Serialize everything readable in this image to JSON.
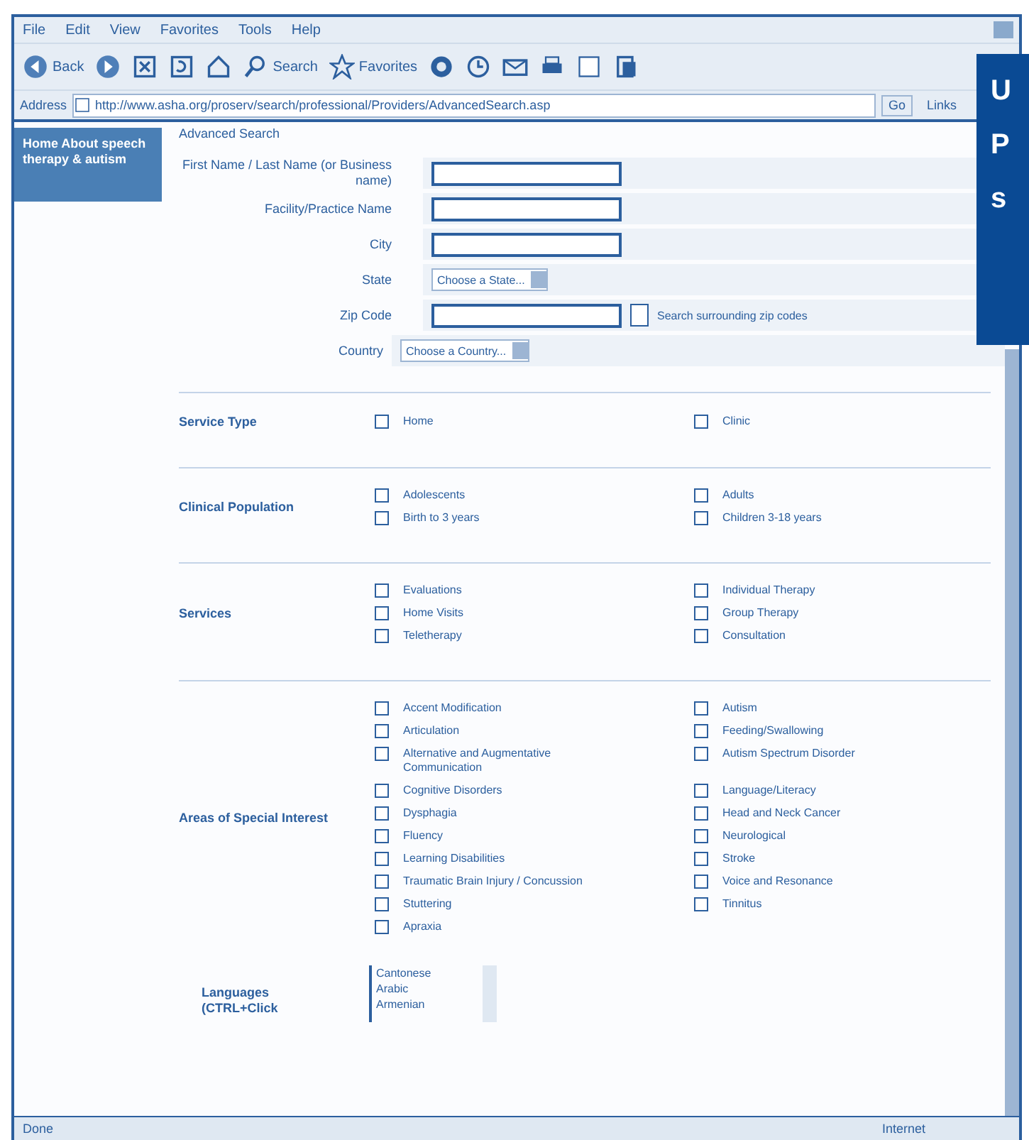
{
  "menu": [
    "File",
    "Edit",
    "View",
    "Favorites",
    "Tools",
    "Help"
  ],
  "toolbar": [
    {
      "kind": "back",
      "label": "Back"
    },
    {
      "kind": "forward"
    },
    {
      "kind": "stop"
    },
    {
      "kind": "refresh"
    },
    {
      "kind": "home"
    },
    {
      "kind": "search",
      "label": "Search"
    },
    {
      "kind": "favorites",
      "label": "Favorites"
    },
    {
      "kind": "media"
    },
    {
      "kind": "history"
    },
    {
      "kind": "mail"
    },
    {
      "kind": "print"
    },
    {
      "kind": "edit"
    },
    {
      "kind": "discuss"
    }
  ],
  "address": {
    "label": "Address",
    "value": "http://www.asha.org/proserv/search/professional/Providers/AdvancedSearch.asp",
    "go": "Go",
    "links": "Links"
  },
  "sidebar": {
    "text": "Home About speech therapy & autism"
  },
  "page_title": "Advanced Search",
  "fields": [
    {
      "kind": "text",
      "label": "First Name / Last Name (or Business name)"
    },
    {
      "kind": "text",
      "label": "Facility/Practice Name"
    },
    {
      "kind": "text",
      "label": "City"
    },
    {
      "kind": "select",
      "label": "State",
      "value": "Choose a State..."
    },
    {
      "kind": "zip",
      "label": "Zip Code",
      "check": "Search surrounding zip codes",
      "checked": false
    },
    {
      "kind": "select",
      "label": "Country",
      "value": "Choose a Country..."
    }
  ],
  "sections": [
    {
      "label": "Service Type",
      "options": [
        {
          "text": "Home",
          "checked": false
        },
        {
          "text": "Clinic",
          "checked": false
        }
      ]
    },
    {
      "label": "Clinical Population",
      "options": [
        {
          "text": "Adolescents",
          "checked": false
        },
        {
          "text": "Adults",
          "checked": false
        },
        {
          "text": "Birth to 3 years",
          "checked": false
        },
        {
          "text": "Children 3-18 years",
          "checked": false
        }
      ]
    },
    {
      "label": "Services",
      "options": [
        {
          "text": "Evaluations",
          "checked": false
        },
        {
          "text": "Individual Therapy",
          "checked": false
        },
        {
          "text": "Home Visits",
          "checked": false
        },
        {
          "text": "Group Therapy",
          "checked": false
        },
        {
          "text": "Teletherapy",
          "checked": false
        },
        {
          "text": "Consultation",
          "checked": false
        }
      ]
    },
    {
      "label": "Areas of Special Interest",
      "options": [
        {
          "text": "Accent Modification",
          "checked": false
        },
        {
          "text": "Autism",
          "checked": false
        },
        {
          "text": "Articulation",
          "checked": false
        },
        {
          "text": "Feeding/Swallowing",
          "checked": false
        },
        {
          "text": "Alternative and Augmentative Communication",
          "checked": false
        },
        {
          "text": "Autism Spectrum Disorder",
          "checked": false
        },
        {
          "text": "Cognitive Disorders",
          "checked": false
        },
        {
          "text": "Language/Literacy",
          "checked": false
        },
        {
          "text": "Dysphagia",
          "checked": false
        },
        {
          "text": "Head and Neck Cancer",
          "checked": false
        },
        {
          "text": "Fluency",
          "checked": false
        },
        {
          "text": "Neurological",
          "checked": false
        },
        {
          "text": "Learning Disabilities",
          "checked": false
        },
        {
          "text": "Stroke",
          "checked": false
        },
        {
          "text": "Traumatic Brain Injury / Concussion",
          "checked": false
        },
        {
          "text": "Voice and Resonance",
          "checked": false
        },
        {
          "text": "Stuttering",
          "checked": false
        },
        {
          "text": "Tinnitus",
          "checked": false
        },
        {
          "text": "Apraxia",
          "checked": false
        }
      ]
    }
  ],
  "languages": {
    "label": "Languages (CTRL+Click",
    "options": [
      "Cantonese",
      "Arabic",
      "Armenian"
    ]
  },
  "status_bar": {
    "text": "Done",
    "zone": "Internet"
  },
  "overlay": [
    "U",
    "P",
    "s"
  ]
}
